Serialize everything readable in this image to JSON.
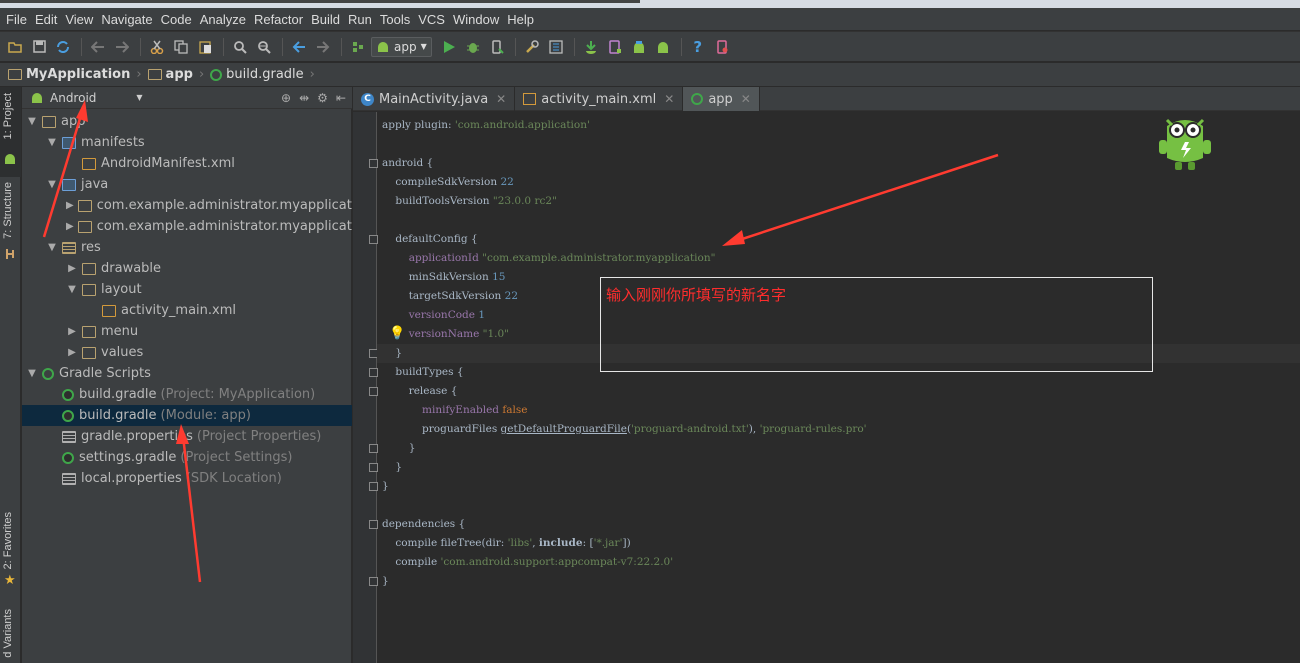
{
  "menu": [
    "File",
    "Edit",
    "View",
    "Navigate",
    "Code",
    "Analyze",
    "Refactor",
    "Build",
    "Run",
    "Tools",
    "VCS",
    "Window",
    "Help"
  ],
  "toolbar": {
    "run_config": "app",
    "icons": [
      "open-icon",
      "save-icon",
      "sync-icon",
      "undo-icon",
      "redo-icon",
      "cut-icon",
      "copy-icon",
      "paste-icon",
      "find-icon",
      "replace-icon",
      "back-icon",
      "forward-icon",
      "make-icon",
      "run-icon",
      "debug-icon",
      "attach-icon",
      "project-structure-icon",
      "sdk-manager-icon",
      "avd-manager-icon",
      "android-monitor-icon",
      "help-icon",
      "device-icon"
    ]
  },
  "breadcrumb": [
    {
      "label": "MyApplication",
      "icon": "folder-icon"
    },
    {
      "label": "app",
      "icon": "folder-icon"
    },
    {
      "label": "build.gradle",
      "icon": "gradle-icon"
    }
  ],
  "left_stripe": {
    "project": "1: Project",
    "structure": "7: Structure",
    "favorites": "2: Favorites",
    "variants": "d Variants"
  },
  "project_panel": {
    "view_mode": "Android",
    "tree": [
      {
        "label": "app",
        "hint": "",
        "depth": 0,
        "arrow": "down",
        "icon": "folder"
      },
      {
        "label": "manifests",
        "hint": "",
        "depth": 1,
        "arrow": "down",
        "icon": "srcfolder"
      },
      {
        "label": "AndroidManifest.xml",
        "hint": "",
        "depth": 2,
        "arrow": "",
        "icon": "xml"
      },
      {
        "label": "java",
        "hint": "",
        "depth": 1,
        "arrow": "down",
        "icon": "srcfolder"
      },
      {
        "label": "com.example.administrator.myapplication_",
        "hint": "",
        "depth": 2,
        "arrow": "right",
        "icon": "folder"
      },
      {
        "label": "com.example.administrator.myapplication_",
        "hint": "",
        "depth": 2,
        "arrow": "right",
        "icon": "folder"
      },
      {
        "label": "res",
        "hint": "",
        "depth": 1,
        "arrow": "down",
        "icon": "resfolder"
      },
      {
        "label": "drawable",
        "hint": "",
        "depth": 2,
        "arrow": "right",
        "icon": "folder"
      },
      {
        "label": "layout",
        "hint": "",
        "depth": 2,
        "arrow": "down",
        "icon": "folder"
      },
      {
        "label": "activity_main.xml",
        "hint": "",
        "depth": 3,
        "arrow": "",
        "icon": "xml"
      },
      {
        "label": "menu",
        "hint": "",
        "depth": 2,
        "arrow": "right",
        "icon": "folder"
      },
      {
        "label": "values",
        "hint": "",
        "depth": 2,
        "arrow": "right",
        "icon": "folder"
      },
      {
        "label": "Gradle Scripts",
        "hint": "",
        "depth": 0,
        "arrow": "down",
        "icon": "gscripts"
      },
      {
        "label": "build.gradle",
        "hint": "(Project: MyApplication)",
        "depth": 1,
        "arrow": "",
        "icon": "gradle"
      },
      {
        "label": "build.gradle",
        "hint": "(Module: app)",
        "depth": 1,
        "arrow": "",
        "icon": "gradle",
        "selected": true
      },
      {
        "label": "gradle.properties",
        "hint": "(Project Properties)",
        "depth": 1,
        "arrow": "",
        "icon": "props"
      },
      {
        "label": "settings.gradle",
        "hint": "(Project Settings)",
        "depth": 1,
        "arrow": "",
        "icon": "gradle"
      },
      {
        "label": "local.properties",
        "hint": "(SDK Location)",
        "depth": 1,
        "arrow": "",
        "icon": "props"
      }
    ]
  },
  "tabs": [
    {
      "label": "MainActivity.java",
      "icon": "c",
      "active": false
    },
    {
      "label": "activity_main.xml",
      "icon": "x",
      "active": false
    },
    {
      "label": "app",
      "icon": "g",
      "active": true
    }
  ],
  "code": [
    {
      "line": 0,
      "parts": [
        [
          "t",
          "apply plugin: "
        ],
        [
          "s",
          "'com.android.application'"
        ]
      ]
    },
    {
      "line": 2,
      "parts": [
        [
          "t",
          "android {"
        ]
      ]
    },
    {
      "line": 3,
      "parts": [
        [
          "t",
          "    compileSdkVersion "
        ],
        [
          "n",
          "22"
        ]
      ]
    },
    {
      "line": 4,
      "parts": [
        [
          "t",
          "    buildToolsVersion "
        ],
        [
          "s",
          "\"23.0.0 rc2\""
        ]
      ]
    },
    {
      "line": 6,
      "parts": [
        [
          "t",
          "    defaultConfig {"
        ]
      ]
    },
    {
      "line": 7,
      "parts": [
        [
          "p",
          "        applicationId "
        ],
        [
          "s",
          "\"com.example.administrator.myapplication\""
        ]
      ]
    },
    {
      "line": 8,
      "parts": [
        [
          "t",
          "        minSdkVersion "
        ],
        [
          "n",
          "15"
        ]
      ]
    },
    {
      "line": 9,
      "parts": [
        [
          "t",
          "        targetSdkVersion "
        ],
        [
          "n",
          "22"
        ]
      ]
    },
    {
      "line": 10,
      "parts": [
        [
          "p",
          "        versionCode "
        ],
        [
          "n",
          "1"
        ]
      ]
    },
    {
      "line": 11,
      "parts": [
        [
          "p",
          "        versionName "
        ],
        [
          "s",
          "\"1.0\""
        ]
      ]
    },
    {
      "line": 12,
      "parts": [
        [
          "t",
          "    }"
        ]
      ]
    },
    {
      "line": 13,
      "parts": [
        [
          "t",
          "    buildTypes {"
        ]
      ]
    },
    {
      "line": 14,
      "parts": [
        [
          "t",
          "        release {"
        ]
      ]
    },
    {
      "line": 15,
      "parts": [
        [
          "p",
          "            minifyEnabled "
        ],
        [
          "k",
          "false"
        ]
      ]
    },
    {
      "line": 16,
      "parts": [
        [
          "t",
          "            proguardFiles "
        ],
        [
          "f",
          "getDefaultProguardFile"
        ],
        [
          "t",
          "("
        ],
        [
          "s",
          "'proguard-android.txt'"
        ],
        [
          "t",
          "), "
        ],
        [
          "s",
          "'proguard-rules.pro'"
        ]
      ]
    },
    {
      "line": 17,
      "parts": [
        [
          "t",
          "        }"
        ]
      ]
    },
    {
      "line": 18,
      "parts": [
        [
          "t",
          "    }"
        ]
      ]
    },
    {
      "line": 19,
      "parts": [
        [
          "t",
          "}"
        ]
      ]
    },
    {
      "line": 21,
      "parts": [
        [
          "t",
          "dependencies {"
        ]
      ]
    },
    {
      "line": 22,
      "parts": [
        [
          "t",
          "    compile fileTree(dir: "
        ],
        [
          "s",
          "'libs'"
        ],
        [
          "t",
          ", "
        ],
        [
          "k2",
          "include"
        ],
        [
          "t",
          ": ["
        ],
        [
          "s",
          "'*.jar'"
        ],
        [
          "t",
          "])"
        ]
      ]
    },
    {
      "line": 23,
      "parts": [
        [
          "t",
          "    compile "
        ],
        [
          "s",
          "'com.android.support:appcompat-v7:22.2.0'"
        ]
      ]
    },
    {
      "line": 24,
      "parts": [
        [
          "t",
          "}"
        ]
      ]
    }
  ],
  "annotation": {
    "text": "输入刚刚你所填写的新名字",
    "color": "#ff2d2d"
  },
  "colors": {
    "selection": "#0d293e",
    "keyword": "#cc7832",
    "string": "#6a8759",
    "number": "#6897bb",
    "property": "#9876aa"
  }
}
